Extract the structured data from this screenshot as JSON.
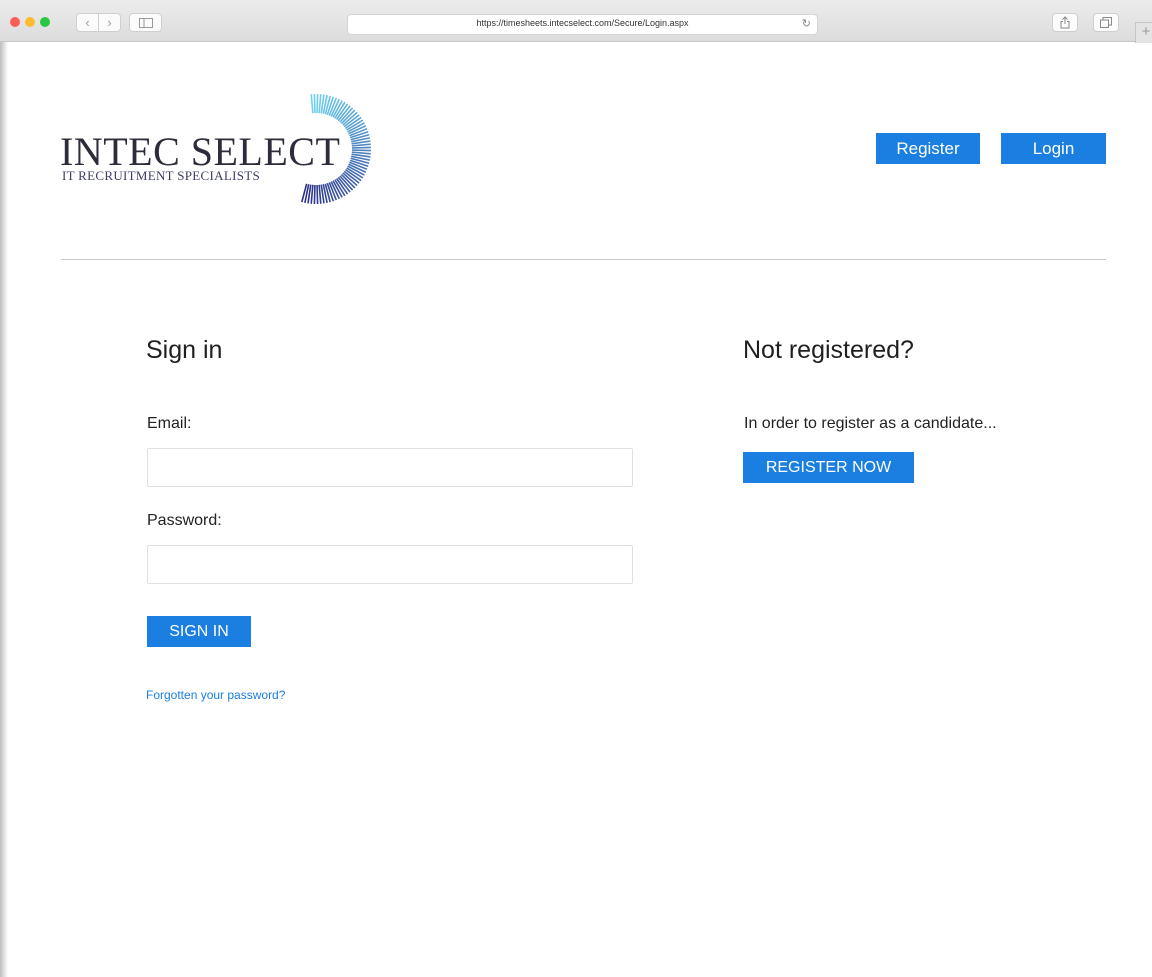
{
  "browser": {
    "url": "https://timesheets.intecselect.com/Secure/Login.aspx"
  },
  "logo": {
    "name": "INTEC SELECT",
    "tagline": "IT RECRUITMENT SPECIALISTS"
  },
  "header": {
    "register_label": "Register",
    "login_label": "Login"
  },
  "signin": {
    "title": "Sign in",
    "email_label": "Email:",
    "email_value": "",
    "password_label": "Password:",
    "password_value": "",
    "button_label": "SIGN IN",
    "forgot_link": "Forgotten your password?"
  },
  "register_panel": {
    "title": "Not registered?",
    "text": "In order to register as a candidate...",
    "button_label": "REGISTER NOW"
  },
  "colors": {
    "accent": "#1a7fe0",
    "logo_arc_start": "#6fd3f0",
    "logo_arc_end": "#2b2f88"
  }
}
